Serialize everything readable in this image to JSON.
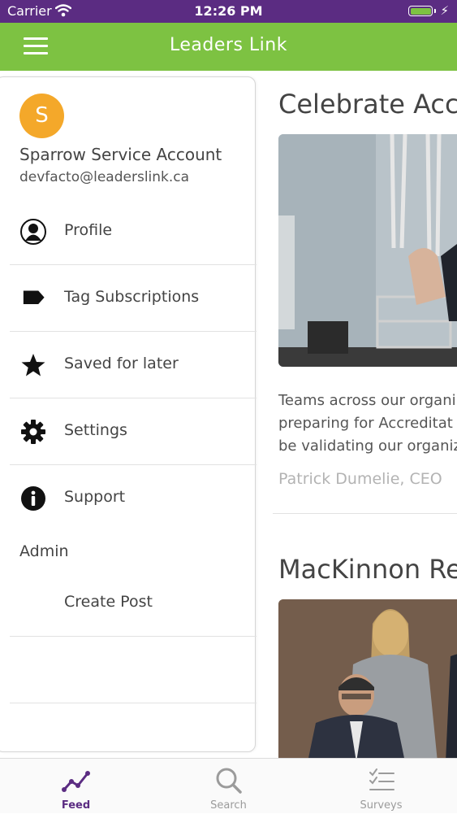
{
  "status_bar": {
    "carrier": "Carrier",
    "time": "12:26 PM",
    "battery_color": "#7dc242"
  },
  "nav_bar": {
    "title": "Leaders Link",
    "menu_icon": "hamburger-icon",
    "color": "#7dc242"
  },
  "feed": {
    "posts": [
      {
        "title": "Celebrate Acc",
        "body_lines": [
          "Teams across our organi",
          "preparing for Accreditat",
          "be validating our organiz"
        ],
        "author": "Patrick Dumelie, CEO"
      },
      {
        "title": "MacKinnon Re"
      }
    ]
  },
  "drawer": {
    "avatar_initial": "S",
    "avatar_color": "#f4a82a",
    "account_name": "Sparrow Service Account",
    "account_email": "devfacto@leaderslink.ca",
    "menu_items": [
      {
        "label": "Profile",
        "icon": "person-icon"
      },
      {
        "label": "Tag Subscriptions",
        "icon": "tag-icon"
      },
      {
        "label": "Saved for later",
        "icon": "star-icon"
      },
      {
        "label": "Settings",
        "icon": "gear-icon"
      },
      {
        "label": "Support",
        "icon": "info-icon"
      }
    ],
    "admin_section": {
      "label": "Admin",
      "items": [
        {
          "label": "Create Post"
        }
      ]
    }
  },
  "tab_bar": {
    "active_color": "#5b2c82",
    "tabs": [
      {
        "label": "Feed",
        "icon": "activity-icon",
        "active": true
      },
      {
        "label": "Search",
        "icon": "search-icon",
        "active": false
      },
      {
        "label": "Surveys",
        "icon": "checklist-icon",
        "active": false
      }
    ]
  }
}
